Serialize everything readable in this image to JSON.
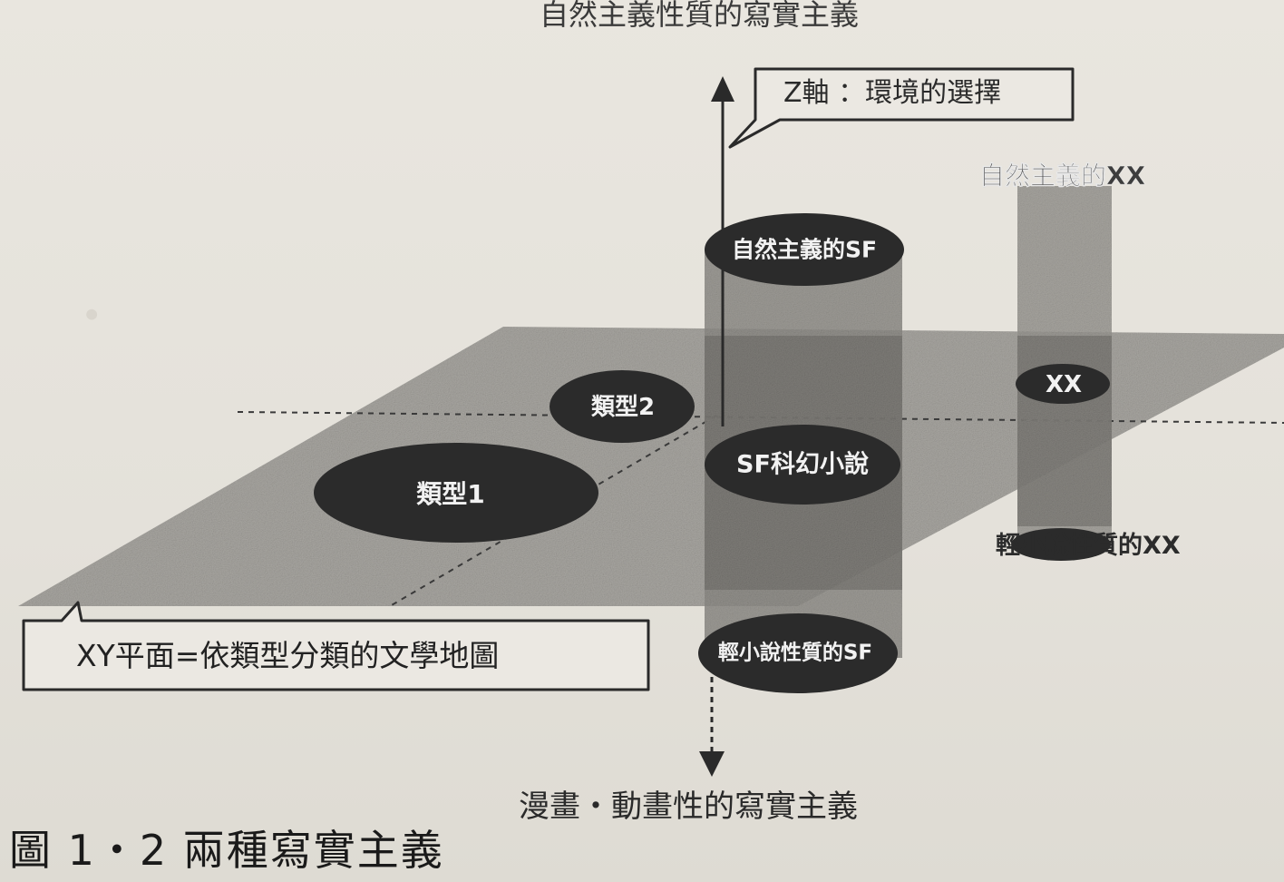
{
  "top_axis_label": "自然主義性質的寫實主義",
  "bottom_axis_label": "漫畫・動畫性的寫實主義",
  "z_axis_callout": "Z軸 ：環境的選擇",
  "xy_plane_callout": "XY平面=依類型分類的文學地圖",
  "figure_caption": "圖 1・2 兩種寫實主義",
  "genre_1": "類型1",
  "genre_2": "類型2",
  "sf_cylinder": {
    "top": "自然主義的SF",
    "middle": "SF科幻小說",
    "bottom": "輕小說性質的SF"
  },
  "xx_cylinder": {
    "top": "自然主義的XX",
    "middle": "XX",
    "bottom": "輕小說性質的XX"
  },
  "colors": {
    "paper": "#e6e3dc",
    "ink": "#1e1e1e",
    "plane": "#9a9893",
    "ellipse": "#2b2b2b"
  }
}
